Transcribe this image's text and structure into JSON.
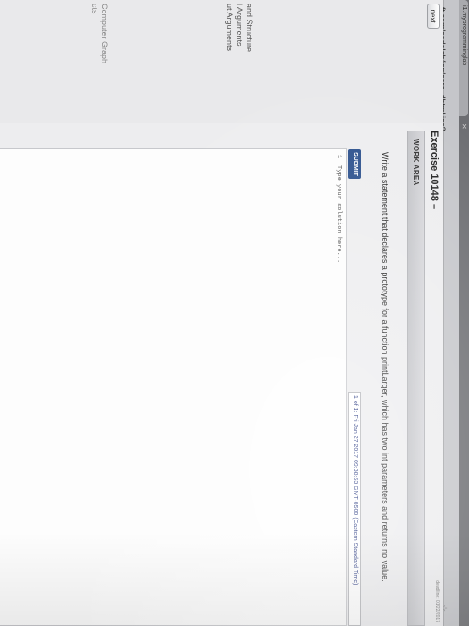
{
  "browser": {
    "tab_title": "i1.myprogramminglab",
    "url": "ft.com/codelab/jsp/core_dhtml.jsp?"
  },
  "sidebar": {
    "next_label": "next",
    "items": [
      {
        "label": "and Structure"
      },
      {
        "label": "l Arguments"
      },
      {
        "label": "ut Arguments"
      },
      {
        "label": "Computer Graph"
      },
      {
        "label": "cts"
      }
    ]
  },
  "exercise": {
    "title": "Exercise 10148 –",
    "deadline": "deadline: 01/22/2017"
  },
  "work_area": {
    "label": "WORK AREA"
  },
  "instructions": {
    "prefix": "Write a ",
    "w_statement": "statement",
    "mid1": " that ",
    "w_declares": "declares",
    "mid2": " a prototype for a function printLarger, which has two ",
    "w_int": "int",
    "mid3": " ",
    "w_parameters": "parameters",
    "mid4": " and returns no ",
    "w_value": "value",
    "suffix": "."
  },
  "submit_label": "SUBMIT",
  "submission_status": "1 of 1: Fri Jan 27 2017 09:38:53 GMT-0500 (Eastern Standard Time)",
  "editor": {
    "line_number": "1",
    "placeholder": "Type your solution here..."
  }
}
